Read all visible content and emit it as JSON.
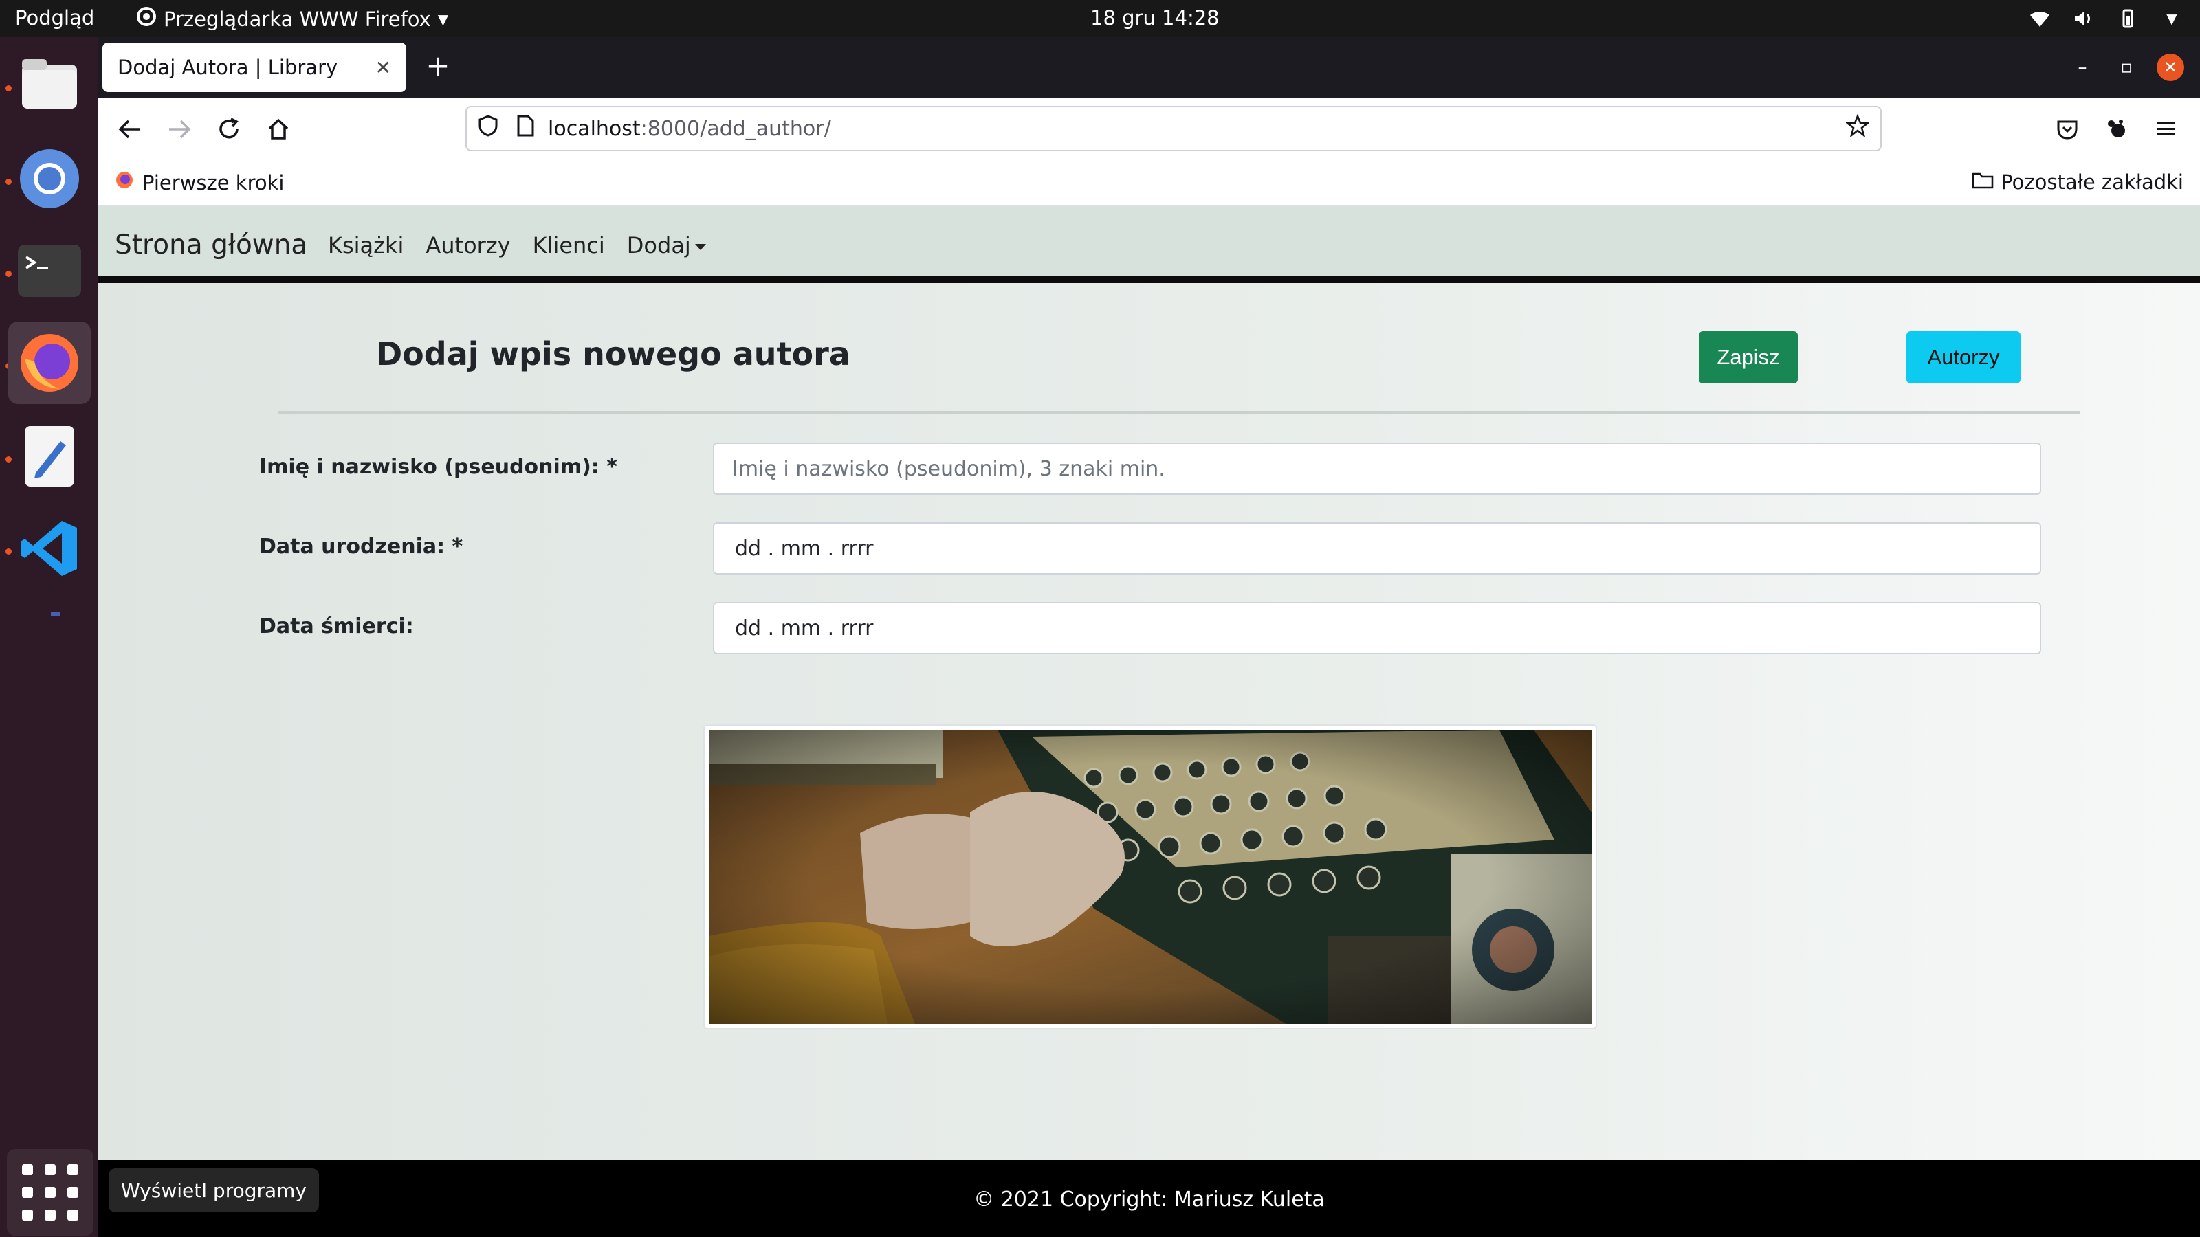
{
  "topbar": {
    "activities": "Podgląd",
    "app_menu": "Przeglądarka WWW Firefox",
    "clock": "18 gru  14:28"
  },
  "dock": {
    "items": [
      "files-icon",
      "chromium-icon",
      "terminal-icon",
      "firefox-icon",
      "text-editor-icon",
      "vscode-icon"
    ],
    "show_apps_tooltip": "Wyświetl programy"
  },
  "browser": {
    "tab_title": "Dodaj Autora | Library",
    "url_host": "localhost",
    "url_path": ":8000/add_author/",
    "bookmark_left": "Pierwsze kroki",
    "bookmark_right": "Pozostałe zakładki"
  },
  "site": {
    "brand": "Strona główna",
    "nav": [
      "Książki",
      "Autorzy",
      "Klienci",
      "Dodaj"
    ],
    "page_title": "Dodaj wpis nowego autora",
    "save_label": "Zapisz",
    "authors_label": "Autorzy",
    "form": {
      "name_label": "Imię i nazwisko (pseudonim): *",
      "name_placeholder": "Imię i nazwisko (pseudonim), 3 znaki min.",
      "birth_label": "Data urodzenia: *",
      "birth_value": "dd . mm . rrrr",
      "death_label": "Data śmierci:",
      "death_value": "dd . mm . rrrr"
    },
    "footer": "© 2021 Copyright: Mariusz Kuleta"
  },
  "colors": {
    "save": "#198754",
    "authors": "#0dcaf0",
    "nav_bg": "#d8e2dc",
    "ubuntu_orange": "#e95420"
  }
}
